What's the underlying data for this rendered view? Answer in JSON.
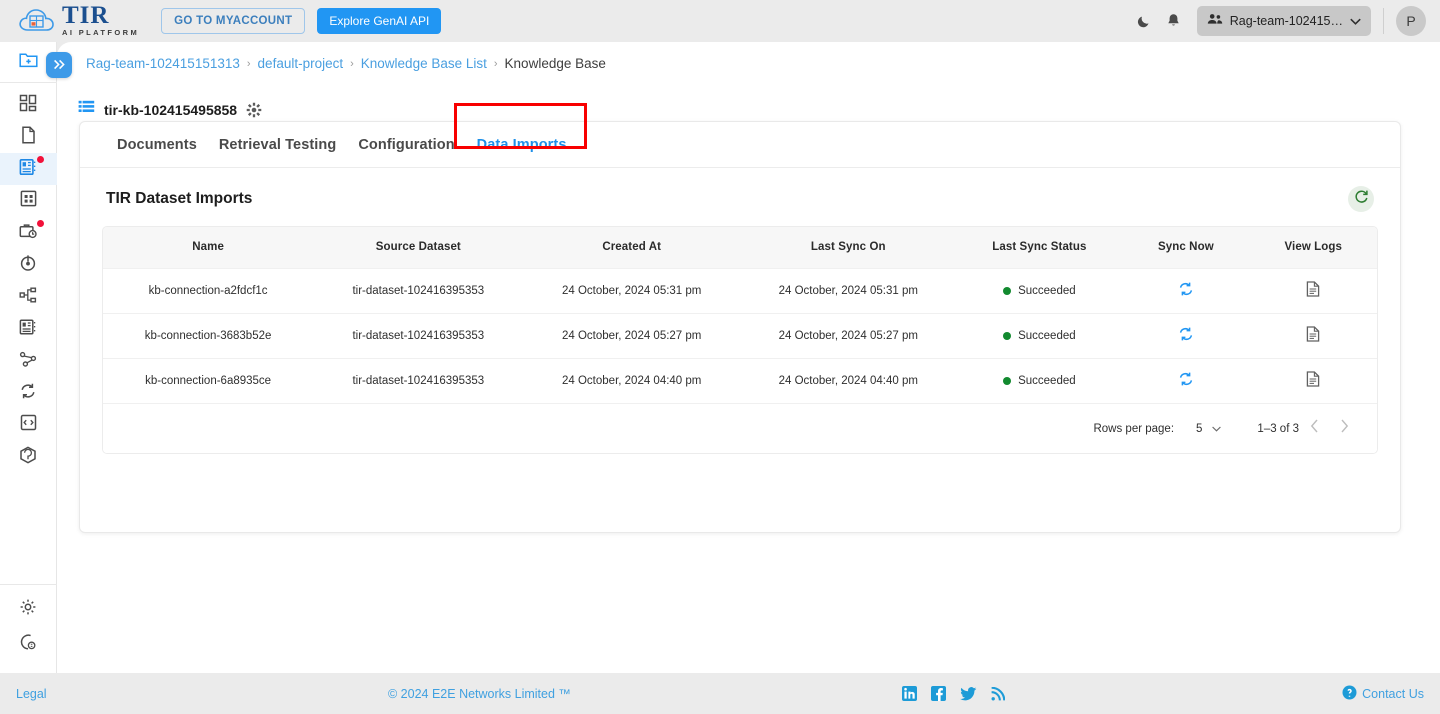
{
  "header": {
    "logo_title": "TIR",
    "logo_subtitle": "AI PLATFORM",
    "myaccount_label": "GO TO MYACCOUNT",
    "genai_label": "Explore GenAI API",
    "dark_mode_icon": "moon-icon",
    "notification_icon": "bell-icon",
    "team_name": "Rag-team-102415…",
    "team_icon": "people-icon",
    "dropdown_icon": "caret-down-icon",
    "avatar_initial": "P"
  },
  "sidebar": {
    "items": [
      {
        "name": "new-project",
        "icon": "folder-plus-icon",
        "active": false,
        "badge": false
      },
      {
        "name": "dashboard",
        "icon": "grid-icon",
        "active": false,
        "badge": false
      },
      {
        "name": "documents",
        "icon": "file-icon",
        "active": false,
        "badge": false
      },
      {
        "name": "knowledge-base",
        "icon": "book-icon",
        "active": true,
        "badge": true
      },
      {
        "name": "datasets",
        "icon": "table-icon",
        "active": false,
        "badge": false
      },
      {
        "name": "jobs",
        "icon": "briefcase-clock-icon",
        "active": false,
        "badge": true
      },
      {
        "name": "inference",
        "icon": "target-icon",
        "active": false,
        "badge": false
      },
      {
        "name": "pipelines",
        "icon": "hierarchy-icon",
        "active": false,
        "badge": false
      },
      {
        "name": "model-repository",
        "icon": "server-icon",
        "active": false,
        "badge": false
      },
      {
        "name": "nodes",
        "icon": "share-nodes-icon",
        "active": false,
        "badge": false
      },
      {
        "name": "sync",
        "icon": "sync-icon",
        "active": false,
        "badge": false
      },
      {
        "name": "api-tokens",
        "icon": "code-box-icon",
        "active": false,
        "badge": false
      },
      {
        "name": "containers",
        "icon": "cube-icon",
        "active": false,
        "badge": false
      }
    ],
    "bottom_items": [
      {
        "name": "settings",
        "icon": "gear-icon"
      },
      {
        "name": "help",
        "icon": "help-circle-icon"
      }
    ],
    "collapse_icon": "chevrons-right-icon"
  },
  "breadcrumb": {
    "items": [
      {
        "label": "Rag-team-102415151313",
        "link": true
      },
      {
        "label": "default-project",
        "link": true
      },
      {
        "label": "Knowledge Base List",
        "link": true
      },
      {
        "label": "Knowledge Base",
        "link": false
      }
    ],
    "separator": "›"
  },
  "kb": {
    "icon": "list-blue-icon",
    "title": "tir-kb-102415495858",
    "settings_icon": "gear-icon"
  },
  "tabs": [
    {
      "label": "Documents",
      "active": false
    },
    {
      "label": "Retrieval Testing",
      "active": false
    },
    {
      "label": "Configuration",
      "active": false
    },
    {
      "label": "Data Imports",
      "active": true,
      "highlighted": true
    }
  ],
  "highlight_color": "#f80000",
  "accent_color": "#2196f3",
  "section": {
    "title": "TIR Dataset Imports",
    "refresh_icon": "refresh-icon",
    "refresh_color": "#2e7d32"
  },
  "table": {
    "columns": [
      "Name",
      "Source Dataset",
      "Created At",
      "Last Sync On",
      "Last Sync Status",
      "Sync Now",
      "View Logs"
    ],
    "rows": [
      {
        "name": "kb-connection-a2fdcf1c",
        "source_dataset": "tir-dataset-102416395353",
        "created_at": "24 October, 2024 05:31 pm",
        "last_sync_on": "24 October, 2024 05:31 pm",
        "last_sync_status": "Succeeded",
        "status_color": "#128a2f",
        "sync_now_icon": "sync-icon",
        "view_logs_icon": "document-icon"
      },
      {
        "name": "kb-connection-3683b52e",
        "source_dataset": "tir-dataset-102416395353",
        "created_at": "24 October, 2024 05:27 pm",
        "last_sync_on": "24 October, 2024 05:27 pm",
        "last_sync_status": "Succeeded",
        "status_color": "#128a2f",
        "sync_now_icon": "sync-icon",
        "view_logs_icon": "document-icon"
      },
      {
        "name": "kb-connection-6a8935ce",
        "source_dataset": "tir-dataset-102416395353",
        "created_at": "24 October, 2024 04:40 pm",
        "last_sync_on": "24 October, 2024 04:40 pm",
        "last_sync_status": "Succeeded",
        "status_color": "#128a2f",
        "sync_now_icon": "sync-icon",
        "view_logs_icon": "document-icon"
      }
    ]
  },
  "pagination": {
    "rows_per_page_label": "Rows per page:",
    "rows_per_page_value": "5",
    "range_label": "1–3 of 3",
    "prev_icon": "chevron-left-icon",
    "next_icon": "chevron-right-icon"
  },
  "footer": {
    "legal": "Legal",
    "copyright": "© 2024 E2E Networks Limited ™",
    "social": [
      {
        "name": "linkedin-icon"
      },
      {
        "name": "facebook-icon"
      },
      {
        "name": "twitter-icon"
      },
      {
        "name": "rss-icon"
      }
    ],
    "contact": "Contact Us",
    "contact_icon": "help-circle-icon"
  }
}
